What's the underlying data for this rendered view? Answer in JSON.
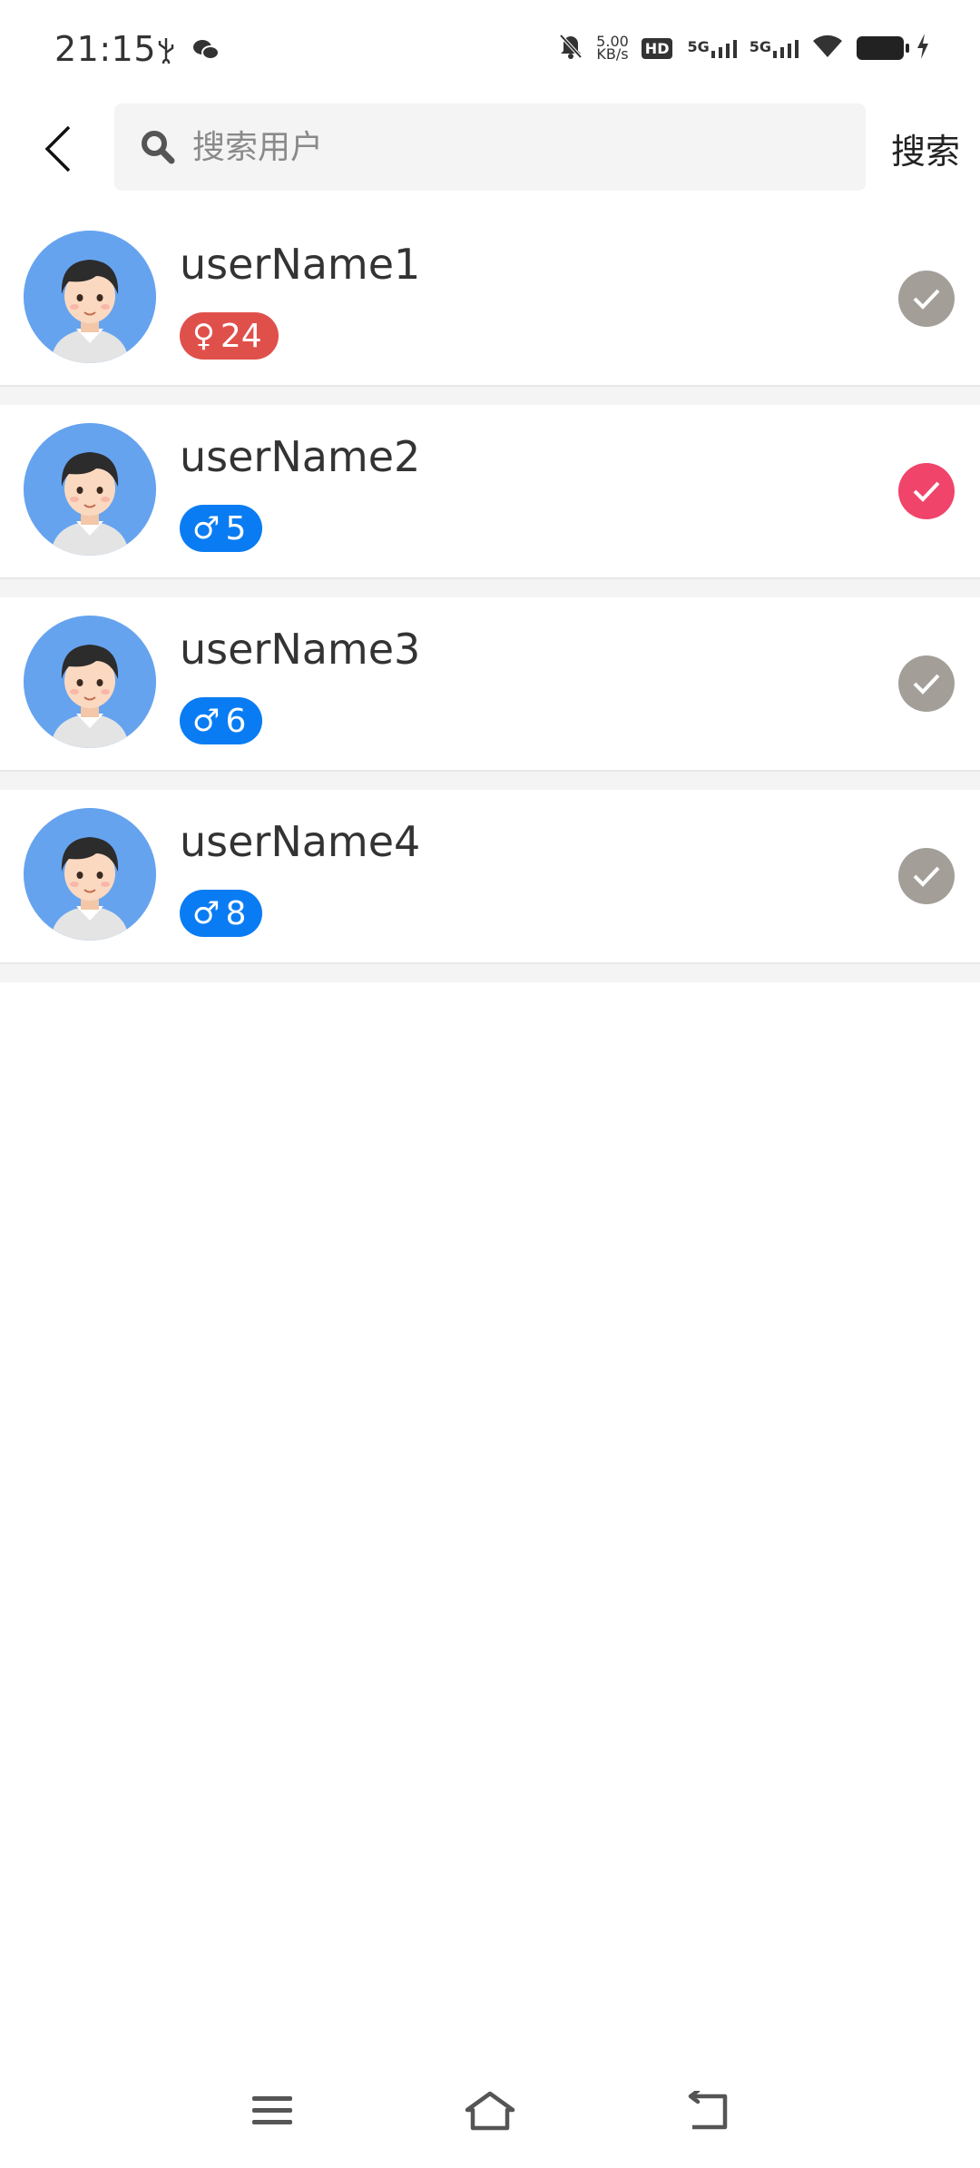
{
  "status_bar": {
    "time": "21:15",
    "speed_value": "5.00",
    "speed_unit": "KB/s",
    "hd_label": "HD",
    "network1": "5G",
    "network2": "5G"
  },
  "search": {
    "placeholder": "搜索用户",
    "button_label": "搜索"
  },
  "users": [
    {
      "name": "userName1",
      "gender": "female",
      "gender_symbol": "♀",
      "age": "24",
      "selected": false
    },
    {
      "name": "userName2",
      "gender": "male",
      "gender_symbol": "♂",
      "age": "5",
      "selected": true
    },
    {
      "name": "userName3",
      "gender": "male",
      "gender_symbol": "♂",
      "age": "6",
      "selected": false
    },
    {
      "name": "userName4",
      "gender": "male",
      "gender_symbol": "♂",
      "age": "8",
      "selected": false
    }
  ],
  "colors": {
    "female_badge": "#e0504b",
    "male_badge": "#0a7cf3",
    "check_selected": "#f0446a",
    "check_unselected": "#a39e98"
  },
  "nav_icons": [
    "menu-icon",
    "home-icon",
    "back-nav-icon"
  ]
}
